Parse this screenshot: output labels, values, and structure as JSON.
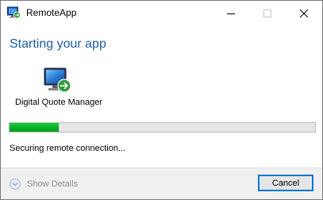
{
  "window": {
    "title": "RemoteApp"
  },
  "main": {
    "heading": "Starting your app",
    "program_name": "Digital Quote Manager",
    "program_icon": "remoteapp-monitor-icon",
    "progress_fraction": 0.16,
    "status": "Securing remote connection..."
  },
  "footer": {
    "details_label": "Show Details",
    "details_icon": "chevron-down-icon",
    "cancel_label": "Cancel"
  },
  "colors": {
    "heading": "#1f5ca8",
    "progress_fill": "#06b025",
    "focus_border": "#0078d7"
  }
}
